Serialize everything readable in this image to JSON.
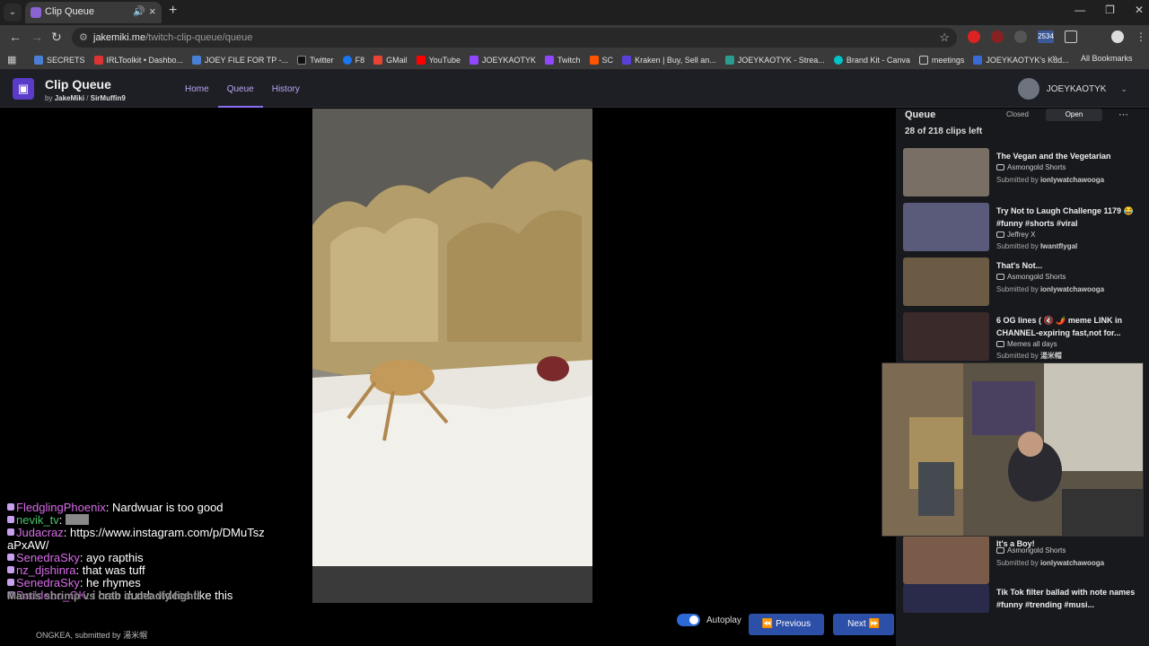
{
  "browser": {
    "tab_title": "Clip Queue",
    "url_host": "jakemiki.me",
    "url_path": "/twitch-clip-queue/queue",
    "bookmarks": [
      "SECRETS",
      "IRLToolkit • Dashbo...",
      "JOEY FILE FOR TP -...",
      "Twitter",
      "F8",
      "GMail",
      "YouTube",
      "JOEYKAOTYK",
      "Twitch",
      "SC",
      "Kraken | Buy, Sell an...",
      "JOEYKAOTYK - Strea...",
      "Brand Kit - Canva",
      "meetings",
      "JOEYKAOTYK's Kud..."
    ],
    "all_bookmarks": "All Bookmarks",
    "ext_badge": "2534"
  },
  "app": {
    "title": "Clip Queue",
    "by": "by",
    "author1": "JakeMiki",
    "separator": "/",
    "author2": "SirMuffin9",
    "nav": [
      "Home",
      "Queue",
      "History"
    ],
    "user_name": "JOEYKAOTYK"
  },
  "queue": {
    "title": "Queue",
    "closed_label": "Closed",
    "open_label": "Open",
    "clips_left": "28 of 218 clips left",
    "clips": [
      {
        "title": "The Vegan and the Vegetarian",
        "channel": "Asmongold Shorts",
        "submitted_prefix": "Submitted by",
        "submitter": "ionlywatchawooga"
      },
      {
        "title": "Try Not to Laugh Challenge 1179 😂 #funny #shorts #viral",
        "channel": "Jeffrey X",
        "submitted_prefix": "Submitted by",
        "submitter": "Iwantflygal"
      },
      {
        "title": "That's Not...",
        "channel": "Asmongold Shorts",
        "submitted_prefix": "Submitted by",
        "submitter": "ionlywatchawooga"
      },
      {
        "title": "6 OG lines ( 🔇 🌶️ meme LINK in CHANNEL-expiring fast,not for...",
        "channel": "Memes all days",
        "submitted_prefix": "Submitted by",
        "submitter": "湯米帽"
      },
      {
        "title": "It's a Boy!",
        "channel": "Asmongold Shorts",
        "submitted_prefix": "Submitted by",
        "submitter": "ionlywatchawooga"
      },
      {
        "title": "Tik Tok filter ballad with note names #funny #trending #musi...",
        "channel": "",
        "submitted_prefix": "",
        "submitter": ""
      }
    ]
  },
  "chat": [
    {
      "user": "FledglingPhoenix",
      "text": ": Nardwuar is too good"
    },
    {
      "user": "nevik_tv",
      "text": ":"
    },
    {
      "user": "Judacraz",
      "text": ": https://www.instagram.com/p/DMuTszaPxAW/"
    },
    {
      "user": "SenedraSky",
      "text": ": ayo rapthis"
    },
    {
      "user": "nz_djshinra",
      "text": ": that was tuff"
    },
    {
      "user": "SenedraSky",
      "text": ": he rhymes"
    },
    {
      "user": "Baddebo_OK",
      "text": ": i hate dumb videos like this"
    }
  ],
  "player": {
    "overlay_title": "Mantis shrimp vs crab in deadly fight!",
    "bottom_channel": "ONGKEA",
    "bottom_submitted": ", submitted by",
    "bottom_submitter": "湯米帽",
    "autoplay_label": "Autoplay",
    "autoplay_on": true,
    "prev_label": "Previous",
    "next_label": "Next"
  }
}
